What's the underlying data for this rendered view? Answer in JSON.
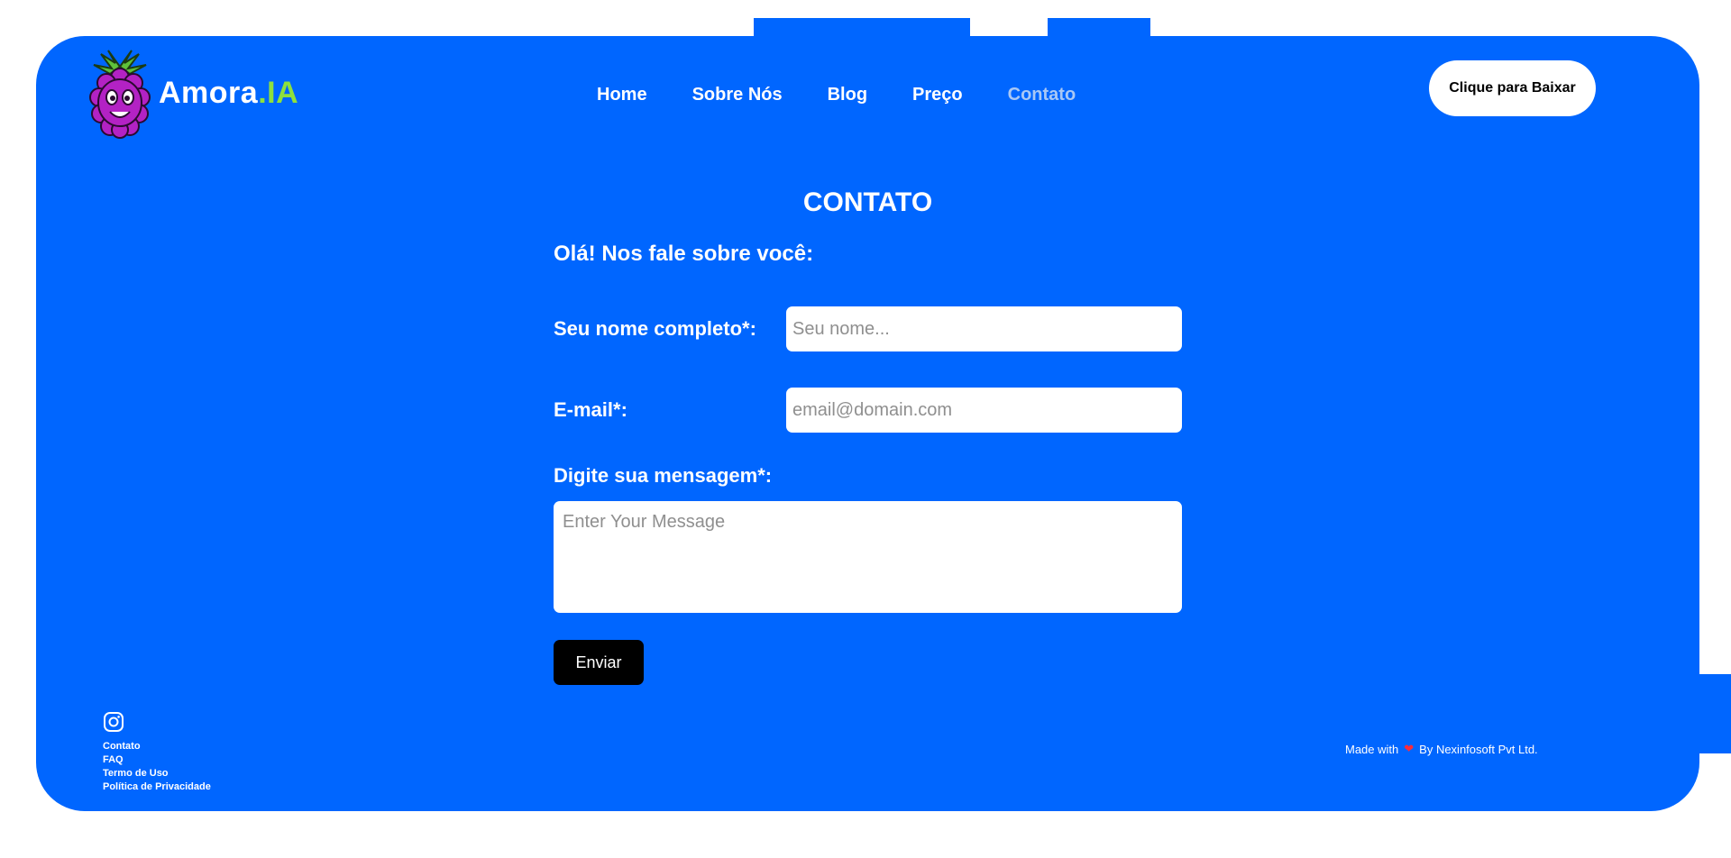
{
  "brand": {
    "name_part1": "Amora",
    "name_part2": ".IA"
  },
  "nav": {
    "items": [
      {
        "label": "Home"
      },
      {
        "label": "Sobre Nós"
      },
      {
        "label": "Blog"
      },
      {
        "label": "Preço"
      },
      {
        "label": "Contato",
        "active": true
      }
    ]
  },
  "header": {
    "cta_label": "Clique para Baixar"
  },
  "main": {
    "title": "CONTATO",
    "intro": "Olá! Nos fale sobre você:",
    "form": {
      "name_label": "Seu nome completo*:",
      "name_placeholder": "Seu nome...",
      "email_label": "E-mail*:",
      "email_placeholder": "email@domain.com",
      "message_label": "Digite sua mensagem*:",
      "message_placeholder": "Enter Your Message",
      "submit_label": "Enviar"
    }
  },
  "footer": {
    "social_icon": "instagram-icon",
    "links": [
      "Contato",
      "FAQ",
      "Termo de Uso",
      "Política de Privacidade"
    ],
    "credit_prefix": "Made with",
    "credit_suffix": "By Nexinfosoft Pvt Ltd.",
    "heart_icon": "heart-icon"
  },
  "colors": {
    "primary": "#0066ff",
    "accent_green": "#8ee03d",
    "nav_active": "#a9c8f5",
    "button_dark": "#000000",
    "heart": "#ff2a3a"
  }
}
